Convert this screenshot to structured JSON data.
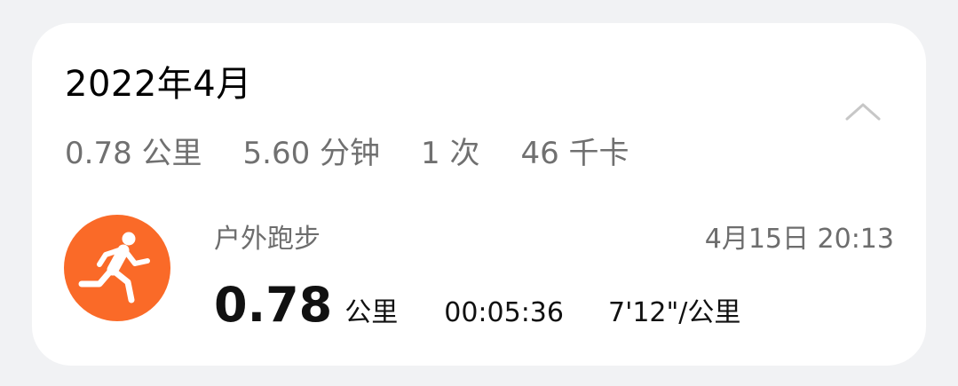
{
  "header": {
    "month": "2022年4月"
  },
  "summary": {
    "distance": "0.78 公里",
    "duration": "5.60 分钟",
    "count": "1 次",
    "calories": "46 千卡"
  },
  "record": {
    "sport_type": "户外跑步",
    "datetime": "4月15日 20:13",
    "distance_value": "0.78",
    "distance_unit": "公里",
    "duration": "00:05:36",
    "pace": "7'12\"/公里",
    "icon": "running-person-icon",
    "icon_color": "#fa6a28"
  },
  "colors": {
    "background": "#f1f2f4",
    "card": "#ffffff",
    "secondary_text": "#707070",
    "primary_text": "#111111"
  }
}
